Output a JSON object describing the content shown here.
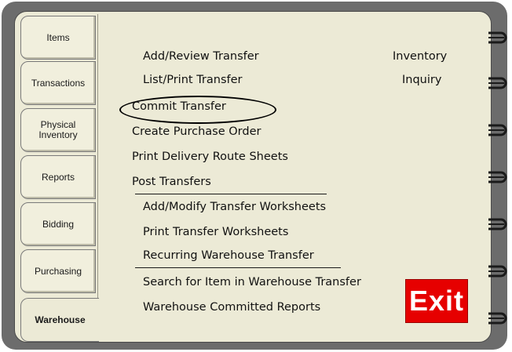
{
  "tabs": [
    {
      "label": "Items"
    },
    {
      "label": "Transactions"
    },
    {
      "label": "Physical\nInventory"
    },
    {
      "label": "Reports"
    },
    {
      "label": "Bidding"
    },
    {
      "label": "Purchasing"
    },
    {
      "label": "Warehouse",
      "active": true
    }
  ],
  "menu": {
    "items": [
      "Add/Review Transfer",
      "List/Print Transfer",
      "Commit Transfer",
      "Create Purchase Order",
      "Print Delivery Route Sheets",
      "Post Transfers",
      "Add/Modify Transfer Worksheets",
      "Print Transfer Worksheets",
      "Recurring Warehouse Transfer",
      "Search for Item in Warehouse Transfer",
      "Warehouse Committed Reports"
    ],
    "highlighted": "Commit Transfer"
  },
  "side": {
    "line1": "Inventory",
    "line2": "Inquiry"
  },
  "exit_label": "Exit",
  "colors": {
    "page": "#ecead6",
    "frame": "#6c6c6c",
    "exit": "#e60000"
  }
}
